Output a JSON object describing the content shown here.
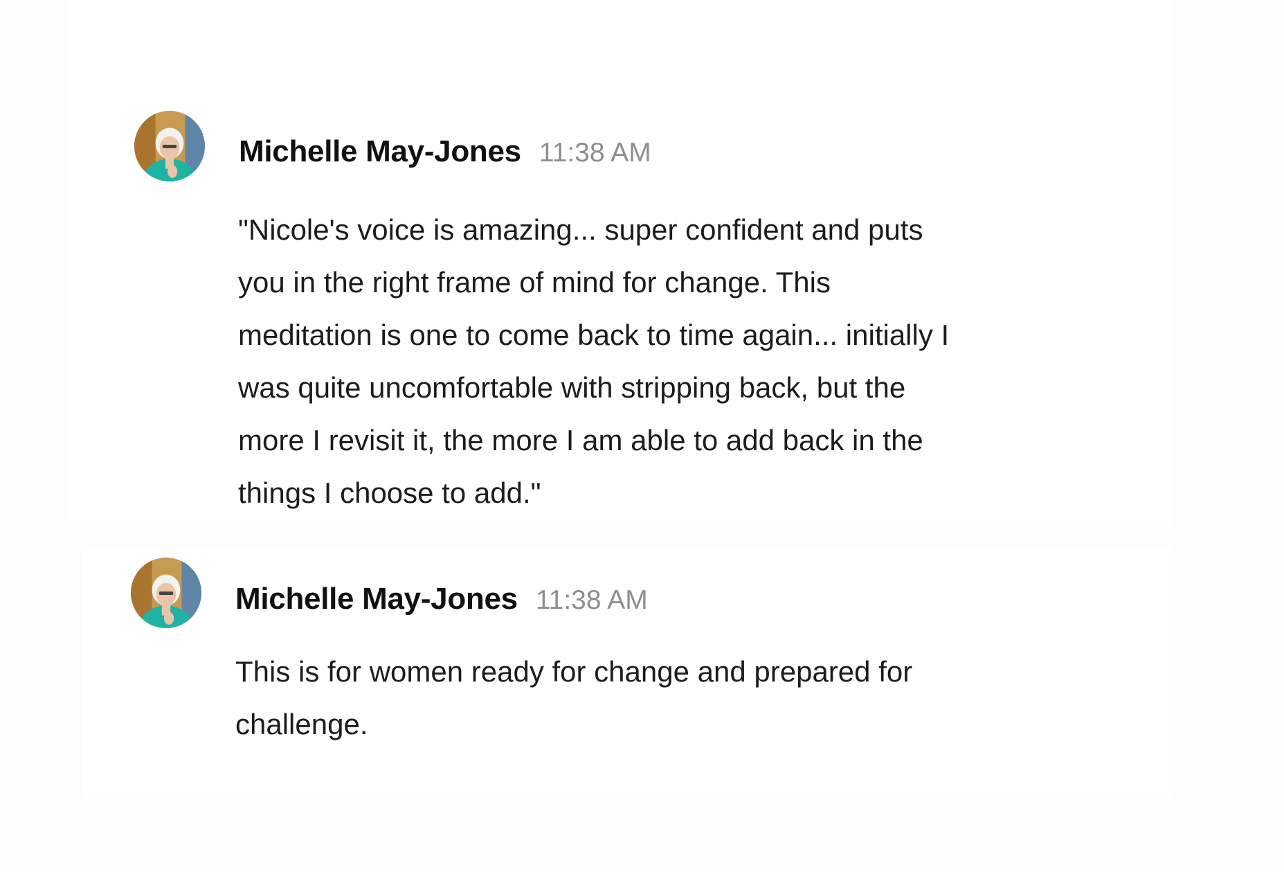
{
  "messages": [
    {
      "author": "Michelle May-Jones",
      "time": "11:38 AM",
      "avatar_icon": "user-avatar-photo",
      "lines": [
        "\"Nicole's voice is amazing... super confident and puts",
        "you in the right frame of mind for change. This",
        "meditation is one to come back to time again... initially I",
        "was quite uncomfortable with stripping back, but the",
        "more I revisit it, the more I am able to add back in the",
        "things I choose to add.\""
      ]
    },
    {
      "author": "Michelle May-Jones",
      "time": "11:38 AM",
      "avatar_icon": "user-avatar-photo",
      "lines": [
        "This is for women ready for change and prepared for",
        "challenge."
      ]
    }
  ]
}
